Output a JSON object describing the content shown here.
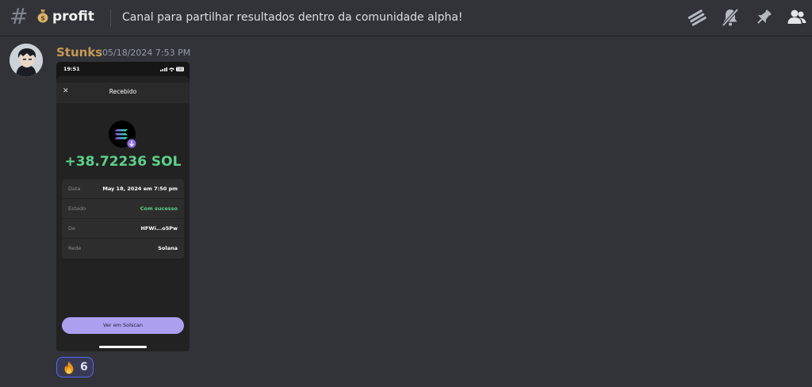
{
  "header": {
    "channel_name": "profit",
    "topic": "Canal para partilhar resultados dentro da comunidade alpha!",
    "icons": [
      "threads-icon",
      "notifications-muted-icon",
      "pin-icon",
      "members-icon"
    ]
  },
  "message": {
    "username": "Stunks",
    "timestamp": "05/18/2024 7:53 PM",
    "attachment": {
      "status_time": "19:51",
      "battery": "100",
      "sheet_title": "Recebido",
      "amount": "+38.72236 SOL",
      "details": [
        {
          "label": "Data",
          "value": "May 18, 2024 em 7:50 pm"
        },
        {
          "label": "Estado",
          "value": "Com sucesso"
        },
        {
          "label": "De",
          "value": "HFWi...o5Pw"
        },
        {
          "label": "Rede",
          "value": "Solana"
        }
      ],
      "button_label": "Ver em Solscan"
    },
    "reaction": {
      "emoji": "fire-icon",
      "count": "6"
    }
  },
  "colors": {
    "background": "#313338",
    "username": "#c69a53",
    "amount_green": "#5bd28a",
    "button_purple": "#ad9ff0",
    "reaction_border": "#5865f2"
  }
}
